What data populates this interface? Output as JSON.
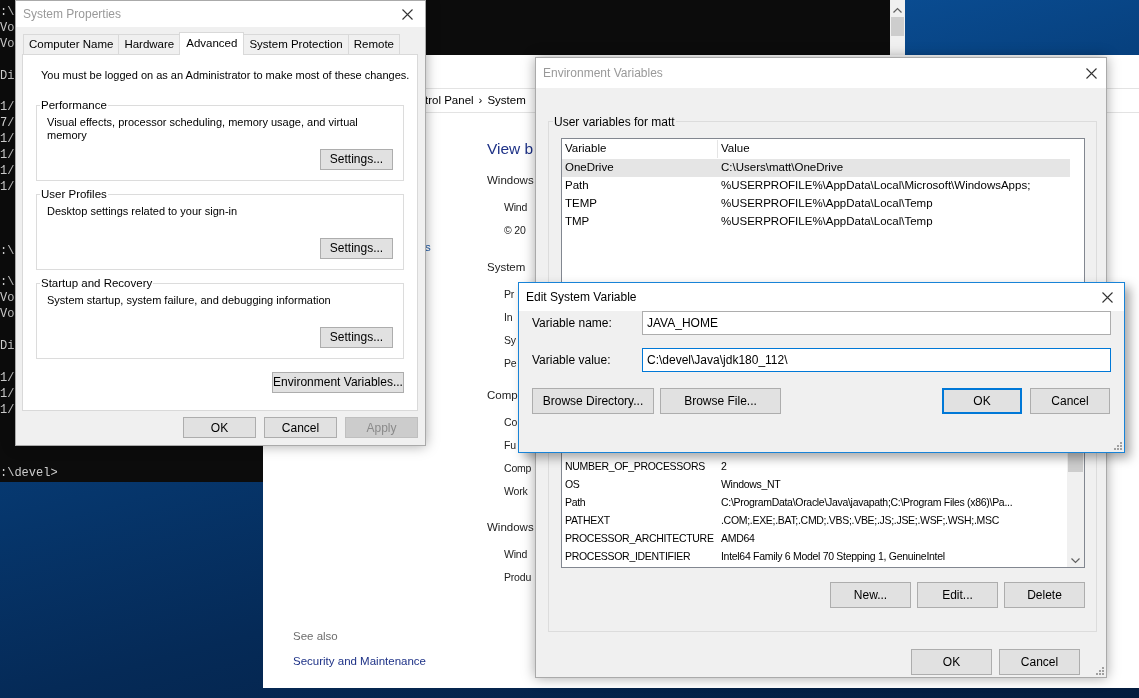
{
  "console": {
    "blocks": [
      [
        ":\\",
        "Vo",
        "Vo"
      ],
      [
        "Di"
      ],
      [
        "1/",
        "7/",
        "1/",
        "1/",
        "1/",
        "1/"
      ],
      [
        ":\\"
      ],
      [
        ":\\",
        "Vo",
        "Vo"
      ],
      [
        "Di"
      ],
      [
        "1/",
        "1/",
        "1/"
      ],
      [
        ":\\devel>"
      ]
    ]
  },
  "control_panel": {
    "breadcrumb": [
      "trol Panel",
      "›",
      "System"
    ],
    "heading": "View b",
    "side_link": "s",
    "sections": [
      {
        "title": "Windows",
        "items": [
          "Wind",
          "© 20"
        ]
      },
      {
        "title": "System",
        "items": [
          "Pr",
          "In",
          "Sy",
          "Pe"
        ]
      },
      {
        "title": "Comp",
        "items": [
          "Co",
          "Fu",
          "Comp",
          "Work"
        ]
      },
      {
        "title": "Windows",
        "items": [
          "Wind",
          "Produ"
        ]
      }
    ],
    "see_also": {
      "title": "See also",
      "links": [
        "Security and Maintenance"
      ]
    }
  },
  "system_properties": {
    "title": "System Properties",
    "active": false,
    "tabs": [
      {
        "label": "Computer Name",
        "selected": false
      },
      {
        "label": "Hardware",
        "selected": false
      },
      {
        "label": "Advanced",
        "selected": true
      },
      {
        "label": "System Protection",
        "selected": false
      },
      {
        "label": "Remote",
        "selected": false
      }
    ],
    "notice": "You must be logged on as an Administrator to make most of these changes.",
    "groups": [
      {
        "title": "Performance",
        "text": "Visual effects, processor scheduling, memory usage, and virtual memory",
        "button": "Settings..."
      },
      {
        "title": "User Profiles",
        "text": "Desktop settings related to your sign-in",
        "button": "Settings..."
      },
      {
        "title": "Startup and Recovery",
        "text": "System startup, system failure, and debugging information",
        "button": "Settings..."
      }
    ],
    "env_button": "Environment Variables...",
    "buttons": [
      {
        "label": "OK",
        "disabled": false
      },
      {
        "label": "Cancel",
        "disabled": false
      },
      {
        "label": "Apply",
        "disabled": true
      }
    ]
  },
  "environment_variables": {
    "title": "Environment Variables",
    "active": false,
    "user_group": {
      "title": "User variables for matt",
      "columns": [
        "Variable",
        "Value"
      ],
      "rows": [
        {
          "variable": "OneDrive",
          "value": "C:\\Users\\matt\\OneDrive",
          "selected": true
        },
        {
          "variable": "Path",
          "value": "%USERPROFILE%\\AppData\\Local\\Microsoft\\WindowsApps;",
          "selected": false
        },
        {
          "variable": "TEMP",
          "value": "%USERPROFILE%\\AppData\\Local\\Temp",
          "selected": false
        },
        {
          "variable": "TMP",
          "value": "%USERPROFILE%\\AppData\\Local\\Temp",
          "selected": false
        }
      ]
    },
    "system_group": {
      "rows": [
        {
          "variable": "NUMBER_OF_PROCESSORS",
          "value": "2",
          "selected": false
        },
        {
          "variable": "OS",
          "value": "Windows_NT",
          "selected": false
        },
        {
          "variable": "Path",
          "value": "C:\\ProgramData\\Oracle\\Java\\javapath;C:\\Program Files (x86)\\Pa...",
          "selected": false
        },
        {
          "variable": "PATHEXT",
          "value": ".COM;.EXE;.BAT;.CMD;.VBS;.VBE;.JS;.JSE;.WSF;.WSH;.MSC",
          "selected": false
        },
        {
          "variable": "PROCESSOR_ARCHITECTURE",
          "value": "AMD64",
          "selected": false
        },
        {
          "variable": "PROCESSOR_IDENTIFIER",
          "value": "Intel64 Family 6 Model 70 Stepping 1, GenuineIntel",
          "selected": false
        }
      ],
      "buttons": [
        "New...",
        "Edit...",
        "Delete"
      ]
    },
    "buttons": [
      "OK",
      "Cancel"
    ]
  },
  "edit_dialog": {
    "title": "Edit System Variable",
    "active": true,
    "fields": [
      {
        "label": "Variable name:",
        "value": "JAVA_HOME",
        "focused": false
      },
      {
        "label": "Variable value:",
        "value": "C:\\devel\\Java\\jdk180_112\\",
        "focused": true
      }
    ],
    "left_buttons": [
      "Browse Directory...",
      "Browse File..."
    ],
    "buttons": [
      {
        "label": "OK",
        "default": true
      },
      {
        "label": "Cancel",
        "default": false
      }
    ]
  }
}
